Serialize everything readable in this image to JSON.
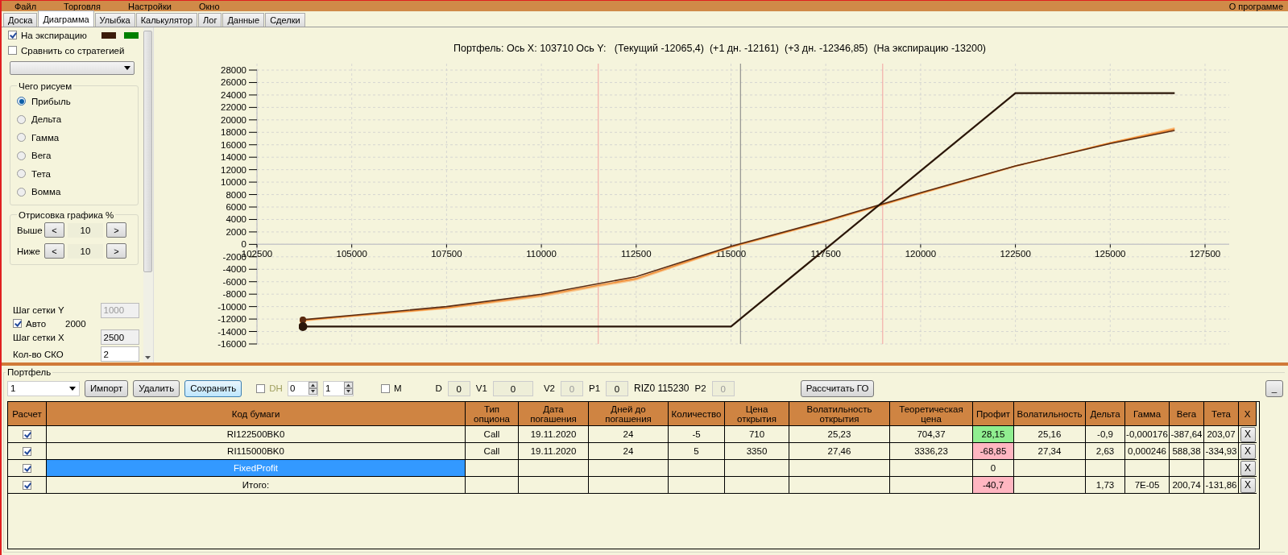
{
  "menu": {
    "items": [
      "Файл",
      "Торговля",
      "Настройки",
      "Окно"
    ],
    "about": "О программе"
  },
  "tabs": [
    {
      "label": "Доска",
      "selected": false
    },
    {
      "label": "Диаграмма",
      "selected": true
    },
    {
      "label": "Улыбка",
      "selected": false
    },
    {
      "label": "Калькулятор",
      "selected": false
    },
    {
      "label": "Лог",
      "selected": false
    },
    {
      "label": "Данные",
      "selected": false
    },
    {
      "label": "Сделки",
      "selected": false
    }
  ],
  "left_panel": {
    "expiry_check": {
      "label": "На экспирацию",
      "checked": true,
      "swatches": [
        {
          "color": "#3b1c0a"
        },
        {
          "color": "#008000"
        }
      ]
    },
    "compare_check": {
      "label": "Сравнить со стратегией",
      "checked": false
    },
    "draw_group": {
      "title": "Чего рисуем",
      "options": [
        {
          "label": "Прибыль",
          "selected": true
        },
        {
          "label": "Дельта",
          "selected": false
        },
        {
          "label": "Гамма",
          "selected": false
        },
        {
          "label": "Вега",
          "selected": false
        },
        {
          "label": "Тета",
          "selected": false
        },
        {
          "label": "Вомма",
          "selected": false
        }
      ]
    },
    "range_group": {
      "title": "Отрисовка графика %",
      "rows": [
        {
          "label": "Выше",
          "dec": "<",
          "value": "10",
          "inc": ">"
        },
        {
          "label": "Ниже",
          "dec": "<",
          "value": "10",
          "inc": ">"
        }
      ]
    },
    "grid_y": {
      "label": "Шаг сетки Y",
      "value": "1000",
      "disabled": true
    },
    "auto": {
      "label": "Авто",
      "checked": true,
      "value": "2000"
    },
    "grid_x": {
      "label": "Шаг сетки X",
      "value": "2500",
      "disabled": false
    },
    "sko": {
      "label": "Кол-во СКО",
      "value": "2",
      "disabled": false
    }
  },
  "chart": {
    "chart_data": {
      "type": "line",
      "title": "Портфель: Ось X: 103710 Ось Y:   (Текущий -12065,4)  (+1 дн. -12161)  (+3 дн. -12346,85)  (На экспирацию -13200)",
      "x": [
        103710,
        105000,
        107500,
        110000,
        112500,
        115000,
        117500,
        120000,
        122500,
        125000,
        126700
      ],
      "series": [
        {
          "color": "#f8c48a",
          "values": [
            -12300,
            -11600,
            -10300,
            -8400,
            -5700,
            -500,
            3600,
            8100,
            12500,
            16300,
            18700
          ]
        },
        {
          "color": "#f08a30",
          "values": [
            -12200,
            -11500,
            -10200,
            -8200,
            -5500,
            -400,
            3700,
            8200,
            12600,
            16300,
            18500
          ]
        },
        {
          "color": "#5a2a10",
          "values": [
            -12100,
            -11400,
            -10000,
            -8000,
            -5200,
            -300,
            3800,
            8300,
            12600,
            16200,
            18300
          ]
        },
        {
          "color": "#2a1608",
          "values": [
            -13200,
            -13200,
            -13200,
            -13200,
            -13200,
            -13200,
            -700,
            11800,
            24300,
            24300,
            24300
          ]
        }
      ],
      "xlim": [
        102500,
        127500
      ],
      "ylim": [
        -16000,
        28000
      ],
      "xticks": [
        102500,
        105000,
        107500,
        110000,
        112500,
        115000,
        117500,
        120000,
        122500,
        125000,
        127500
      ],
      "yticks": [
        -16000,
        -14000,
        -12000,
        -10000,
        -8000,
        -6000,
        -4000,
        -2000,
        0,
        2000,
        4000,
        6000,
        8000,
        10000,
        12000,
        14000,
        16000,
        18000,
        20000,
        22000,
        24000,
        26000,
        28000
      ],
      "grid": true,
      "ref_lines": [
        {
          "axis": "x",
          "value": 111500,
          "color": "#f4a0a0"
        },
        {
          "axis": "x",
          "value": 115250,
          "color": "#808080"
        },
        {
          "axis": "x",
          "value": 119000,
          "color": "#f4a0a0"
        }
      ]
    }
  },
  "portfolio": {
    "title": "Портфель",
    "combo": "1",
    "buttons": [
      {
        "label": "Импорт",
        "selected": false
      },
      {
        "label": "Удалить",
        "selected": false
      },
      {
        "label": "Сохранить",
        "selected": true
      }
    ],
    "dh": {
      "label": "DH",
      "checked": false,
      "disabled": true
    },
    "spinners": [
      "0",
      "1"
    ],
    "m": {
      "label": "M",
      "checked": false
    },
    "fields": [
      {
        "kind": "field",
        "label": "D",
        "value": "0",
        "disabled": false
      },
      {
        "kind": "field",
        "label": "V1",
        "value": "0",
        "disabled": false
      },
      {
        "kind": "field",
        "label": "V2",
        "value": "0",
        "disabled": true
      },
      {
        "kind": "field",
        "label": "P1",
        "value": "0",
        "disabled": false
      },
      {
        "kind": "text",
        "text": "RIZ0 115230"
      },
      {
        "kind": "field",
        "label": "P2",
        "value": "0",
        "disabled": true
      }
    ],
    "calc_button": "Рассчитать ГО",
    "minimize_button": "_"
  },
  "table": {
    "columns": [
      "Расчет",
      "Код бумаги",
      "Тип опциона",
      "Дата погашения",
      "Дней до погашения",
      "Количество",
      "Цена открытия",
      "Волатильность открытия",
      "Теоретическая цена",
      "Профит",
      "Волатильность",
      "Дельта",
      "Гамма",
      "Вега",
      "Тета",
      "X"
    ],
    "rows": [
      {
        "selected": false,
        "cells": [
          {
            "checked": true
          },
          "RI122500BK0",
          "Call",
          "19.11.2020",
          "24",
          "-5",
          "710",
          "25,23",
          "704,37",
          {
            "text": "28,15",
            "color": "#90ee90"
          },
          "25,16",
          "-0,9",
          "-0,000176",
          "-387,64",
          "203,07",
          {
            "button": "X"
          }
        ]
      },
      {
        "selected": false,
        "cells": [
          {
            "checked": true
          },
          "RI115000BK0",
          "Call",
          "19.11.2020",
          "24",
          "5",
          "3350",
          "27,46",
          "3336,23",
          {
            "text": "-68,85",
            "color": "#ffb6c1"
          },
          "27,34",
          "2,63",
          "0,000246",
          "588,38",
          "-334,93",
          {
            "button": "X"
          }
        ]
      },
      {
        "selected": true,
        "cells": [
          {
            "checked": true
          },
          "FixedProfit",
          "",
          "",
          "",
          "",
          "",
          "",
          "",
          {
            "text": "0"
          },
          "",
          "",
          "",
          "",
          "",
          {
            "button": "X"
          }
        ]
      },
      {
        "selected": false,
        "cells": [
          {
            "checked": true
          },
          "Итого:",
          "",
          "",
          "",
          "",
          "",
          "",
          "",
          {
            "text": "-40,7",
            "color": "#ffb6c1"
          },
          "",
          "1,73",
          "7E-05",
          "200,74",
          "-131,86",
          {
            "button": "X"
          }
        ]
      }
    ]
  }
}
